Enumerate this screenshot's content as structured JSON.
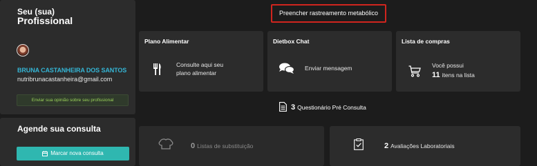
{
  "profile": {
    "title_line1": "Seu (sua)",
    "title_line2": "Profissional",
    "name": "BRUNA CASTANHEIRA DOS SANTOS",
    "email": "nutribrunacastanheira@gmail.com",
    "feedback_button": "Enviar sua opinião sobre seu profissional"
  },
  "schedule": {
    "title": "Agende sua consulta",
    "button": "Marcar nova consulta"
  },
  "metabolic_button": "Preencher rastreamento metabólico",
  "cards": {
    "plan": {
      "title": "Plano Alimentar",
      "line1": "Consulte aqui seu",
      "line2": "plano alimentar",
      "icon": "fork-knife-icon"
    },
    "chat": {
      "title": "Dietbox Chat",
      "text": "Enviar mensagem",
      "icon": "chat-bubbles-icon"
    },
    "shopping": {
      "title": "Lista de compras",
      "line1": "Você possui",
      "count": "11",
      "line2": "itens na lista",
      "icon": "shopping-cart-icon"
    }
  },
  "questionnaire": {
    "count": "3",
    "label": "Questionário Pré Consulta",
    "icon": "document-icon"
  },
  "substitutions": {
    "count": "0",
    "label": "Listas de substituição",
    "icon": "chef-hat-icon"
  },
  "evaluations": {
    "count": "2",
    "label": "Avaliações Laboratoriais",
    "icon": "clipboard-check-icon"
  },
  "colors": {
    "background": "#1c1c1c",
    "card": "#2c2c2c",
    "accent_teal": "#2fb7b0",
    "name_blue": "#35b6d6",
    "highlight_red": "#d2251e",
    "feedback_green": "#9bd25a"
  }
}
